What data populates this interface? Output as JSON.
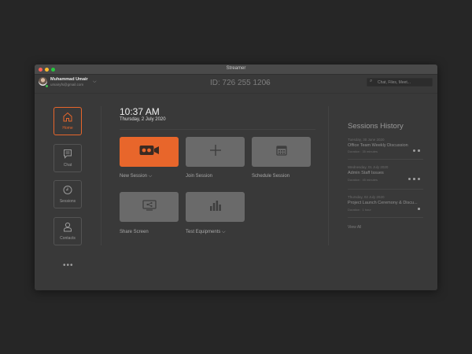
{
  "window": {
    "title": "Streamer"
  },
  "user": {
    "name": "Muhammad Umair",
    "email": "umairyfs@gmail.com"
  },
  "session_id": "ID: 726 255 1206",
  "search": {
    "placeholder": "Chat, Files, Meet..."
  },
  "nav": [
    {
      "label": "Home",
      "icon": "home-icon",
      "active": true
    },
    {
      "label": "Chat",
      "icon": "chat-icon",
      "active": false
    },
    {
      "label": "Sessions",
      "icon": "clock-icon",
      "active": false
    },
    {
      "label": "Contacts",
      "icon": "person-icon",
      "active": false
    }
  ],
  "more": "•••",
  "clock": {
    "time": "10:37 AM",
    "date": "Thursday, 2 July 2020"
  },
  "actions": [
    {
      "label": "New Session",
      "dropdown": true,
      "icon": "video-camera-icon",
      "primary": true
    },
    {
      "label": "Join Session",
      "dropdown": false,
      "icon": "plus-icon",
      "primary": false
    },
    {
      "label": "Schedule Session",
      "dropdown": false,
      "icon": "calendar-icon",
      "primary": false
    },
    {
      "label": "Share Screen",
      "dropdown": false,
      "icon": "share-screen-icon",
      "primary": false
    },
    {
      "label": "Test Equipments",
      "dropdown": true,
      "icon": "bar-chart-icon",
      "primary": false
    }
  ],
  "history": {
    "title": "Sessions History",
    "items": [
      {
        "date": "Tuesday, 30 June 2020",
        "name": "Office Team Weekly Discussion",
        "duration": "Duration : 35 minutes"
      },
      {
        "date": "Wednesday, 01 July 2020",
        "name": "Admin Staff Issues",
        "duration": "Duration : 45 minutes"
      },
      {
        "date": "Thursday, 02 July 2020",
        "name": "Project Launch Ceremony & Discu...",
        "duration": "Duration : 1 hour"
      }
    ],
    "view_all": "View All"
  },
  "colors": {
    "accent": "#e8662b",
    "window": "#393939",
    "background": "#262626",
    "tile": "#6a6a6a"
  }
}
